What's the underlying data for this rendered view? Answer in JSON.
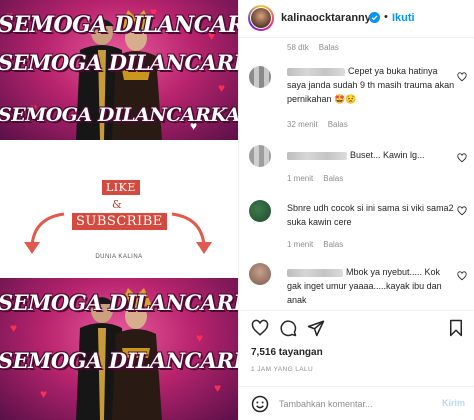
{
  "post": {
    "username": "kalinaocktaranny",
    "follow_label": "Ikuti",
    "separator": "•",
    "views": "7,516 tayangan",
    "time": "1 JAM YANG LALU",
    "add_comment_placeholder": "Tambahkan komentar...",
    "send_label": "Kirim"
  },
  "video": {
    "banner_text": "SEMOGA DILANCARKAN",
    "like_text": "LIKE",
    "amp_text": "&",
    "subscribe_text": "SUBSCRIBE",
    "channel_text": "DUNIA KALINA"
  },
  "top_meta": {
    "age": "58 dtk",
    "reply": "Balas"
  },
  "comments": [
    {
      "text": "Cepet ya buka hatinya saya janda sudah 9 th masih trauma akan pernikahan 🤩😟",
      "age": "32 menit",
      "reply": "Balas",
      "avatar_color": "#9a9a9a"
    },
    {
      "text": "Buset... Kawin lg...",
      "age": "1 menit",
      "reply": "Balas",
      "avatar_color": "#b8b8b8"
    },
    {
      "text": "Sbnre udh cocok si ini sama si viki sama2 suka kawin cere",
      "age": "1 menit",
      "reply": "Balas",
      "avatar_color": "#2e5e3a"
    },
    {
      "text": "Mbok ya nyebut..... Kok gak inget umur yaaaa.....kayak ibu dan anak",
      "age": "",
      "reply": "",
      "avatar_color": "#a08070"
    }
  ],
  "icons": {
    "heart": "heart-icon",
    "comment": "comment-icon",
    "share": "share-icon",
    "save": "bookmark-icon",
    "emoji": "emoji-icon",
    "verified": "verified-icon"
  },
  "colors": {
    "accent": "#0095f6",
    "muted": "#8e8e8e",
    "send_disabled": "#b3dbff"
  }
}
